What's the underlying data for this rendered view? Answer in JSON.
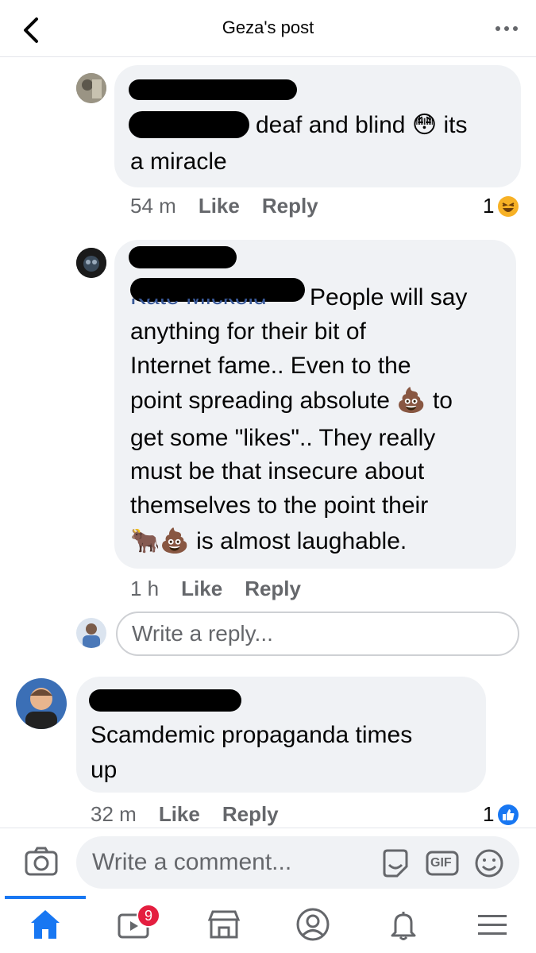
{
  "header": {
    "title": "Geza's post",
    "back_icon": "chevron-left-icon",
    "more_icon": "more-dots-icon"
  },
  "comments": [
    {
      "text_line1": "deaf and blind",
      "emoji1": "😳",
      "text_line1b": "its",
      "text_line2": "a miracle",
      "time": "54 m",
      "like": "Like",
      "reply": "Reply",
      "reaction_count": "1",
      "reaction_icon": "haha-reaction-icon"
    },
    {
      "mention": "Kate Mickold",
      "lines": [
        "People will say",
        "anything for their bit of",
        "Internet fame.. Even to the",
        "point spreading absolute",
        "to",
        "get some \"likes\".. They really",
        "must be that insecure about",
        "themselves to the point their",
        "is almost laughable."
      ],
      "emoji_poop": "💩",
      "emoji_cow": "🐂",
      "time": "1 h",
      "like": "Like",
      "reply": "Reply"
    },
    {
      "lines": [
        "Scamdemic propaganda  times",
        "up"
      ],
      "time": "32 m",
      "like": "Like",
      "reply": "Reply",
      "reaction_count": "1",
      "reaction_icon": "like-reaction-icon"
    }
  ],
  "reply_box": {
    "placeholder": "Write a reply..."
  },
  "comment_bar": {
    "placeholder": "Write a comment...",
    "gif_label": "GIF",
    "icons": [
      "camera-icon",
      "sticker-icon",
      "gif-icon",
      "emoji-icon"
    ]
  },
  "tabbar": {
    "video_badge": "9",
    "icons": [
      "home-icon",
      "video-icon",
      "marketplace-icon",
      "profile-icon",
      "bell-icon",
      "menu-icon"
    ]
  }
}
